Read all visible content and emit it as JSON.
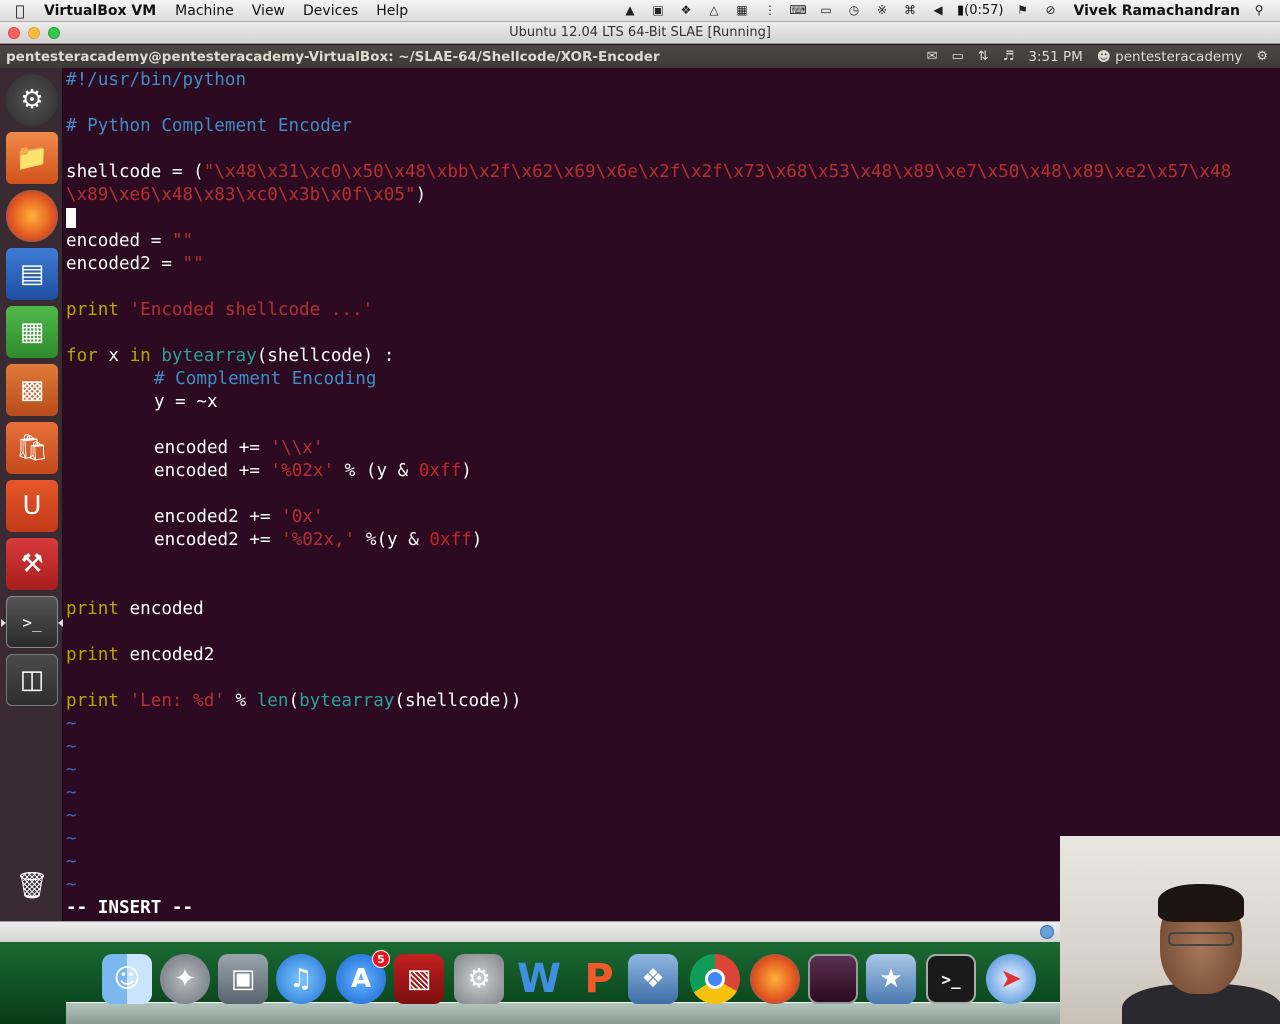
{
  "mac_menubar": {
    "app_name": "VirtualBox VM",
    "menus": [
      "Machine",
      "View",
      "Devices",
      "Help"
    ],
    "battery": "(0:57)",
    "user": "Vivek Ramachandran"
  },
  "vbox_window": {
    "title": "Ubuntu 12.04 LTS 64-Bit SLAE [Running]"
  },
  "ubuntu_panel": {
    "window_title": "pentesteracademy@pentesteracademy-VirtualBox: ~/SLAE-64/Shellcode/XOR-Encoder",
    "time": "3:51 PM",
    "user": "pentesteracademy"
  },
  "launcher": {
    "items": [
      "dash-home",
      "files",
      "firefox",
      "libreoffice-writer",
      "libreoffice-calc",
      "libreoffice-impress",
      "ubuntu-software-center",
      "ubuntu-one",
      "system-settings",
      "terminal",
      "workspace-switcher",
      "trash"
    ]
  },
  "editor": {
    "lines": {
      "l1": "#!/usr/bin/python",
      "l3": "# Python Complement Encoder",
      "l5a": "shellcode = (",
      "l5b": "\"\\x48\\x31\\xc0\\x50\\x48\\xbb\\x2f\\x62\\x69\\x6e\\x2f\\x2f\\x73\\x68\\x53\\x48\\x89\\xe7\\x50\\x48\\x89\\xe2\\x57\\x48",
      "l6a": "\\x89\\xe6\\x48\\x83\\xc0\\x3b\\x0f\\x05\"",
      "l6b": ")",
      "l8a": "encoded = ",
      "l8b": "\"\"",
      "l9a": "encoded2 = ",
      "l9b": "\"\"",
      "l11a": "print",
      "l11b": "'Encoded shellcode ...'",
      "l13a": "for",
      "l13b": " x ",
      "l13c": "in",
      "l13d": "bytearray",
      "l13e": "(shellcode) :",
      "l14": "# Complement Encoding",
      "l15": "y = ~x",
      "l17a": "encoded += ",
      "l17b": "'\\\\x'",
      "l18a": "encoded += ",
      "l18b": "'%02x'",
      "l18c": " % (y & ",
      "l18d": "0xff",
      "l18e": ")",
      "l20a": "encoded2 += ",
      "l20b": "'0x'",
      "l21a": "encoded2 += ",
      "l21b": "'%02x,'",
      "l21c": " %(y & ",
      "l21d": "0xff",
      "l21e": ")",
      "l24a": "print",
      "l24b": " encoded",
      "l26a": "print",
      "l26b": " encoded2",
      "l28a": "print",
      "l28b": "'Len: %d'",
      "l28c": " % ",
      "l28d": "len",
      "l28e": "(",
      "l28f": "bytearray",
      "l28g": "(shellcode))"
    },
    "tilde": "~",
    "mode": "-- INSERT --"
  },
  "dock": {
    "items": [
      "finder",
      "launchpad",
      "image-capture",
      "itunes",
      "app-store",
      "photo-booth",
      "system-preferences",
      "word",
      "powerpoint",
      "virtualbox",
      "chrome",
      "firefox",
      "screen-recording",
      "imovie",
      "terminal",
      "safari"
    ],
    "app_store_badge": "5"
  },
  "colors": {
    "terminal_bg": "#2c0a22",
    "comment": "#3f8cc4",
    "string": "#b43030",
    "keyword": "#b8a500",
    "builtin": "#2aa198"
  }
}
